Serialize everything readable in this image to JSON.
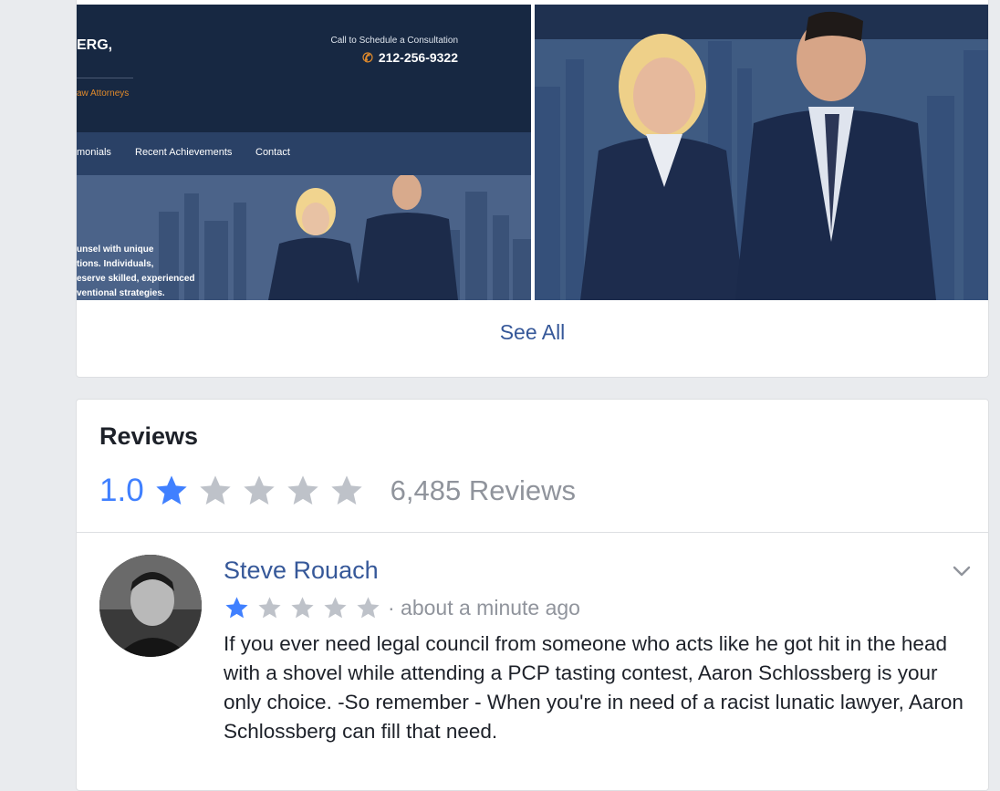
{
  "photos": {
    "site": {
      "firm_fragment": "ERG,",
      "subtitle": "aw Attorneys",
      "call_label": "Call to Schedule a Consultation",
      "phone": "212-256-9322",
      "nav": [
        "monials",
        "Recent Achievements",
        "Contact"
      ],
      "copy": [
        "unsel with unique",
        "tions. Individuals,",
        "eserve skilled, experienced",
        "ventional strategies."
      ]
    },
    "see_all_label": "See All"
  },
  "reviews": {
    "title": "Reviews",
    "rating": "1.0",
    "rating_stars_filled": 1,
    "rating_stars_total": 5,
    "count_label": "6,485 Reviews",
    "colors": {
      "star_filled": "#4080ff",
      "star_empty": "#bec2c9"
    },
    "items": [
      {
        "author": "Steve Rouach",
        "stars_filled": 1,
        "time": "· about a minute ago",
        "text": "If you ever need legal council from someone who acts like he got hit in the head with a shovel while attending a PCP tasting contest, Aaron Schlossberg is your only choice. -So remember - When you're in need of a racist lunatic lawyer, Aaron Schlossberg can fill that need."
      }
    ]
  }
}
